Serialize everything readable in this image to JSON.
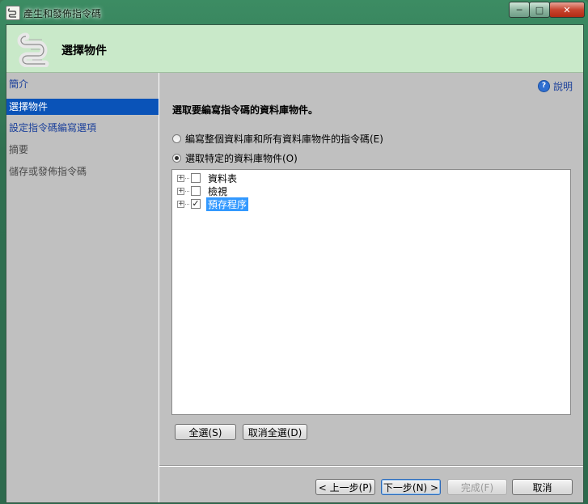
{
  "window": {
    "title": "產生和發佈指令碼",
    "controls": {
      "minimize": "─",
      "maximize": "□",
      "close": "✕"
    }
  },
  "header": {
    "title": "選擇物件",
    "icon": "script-scroll-icon"
  },
  "sidebar": {
    "items": [
      {
        "label": "簡介",
        "state": "link"
      },
      {
        "label": "選擇物件",
        "state": "selected"
      },
      {
        "label": "設定指令碼編寫選項",
        "state": "link"
      },
      {
        "label": "摘要",
        "state": "muted"
      },
      {
        "label": "儲存或發佈指令碼",
        "state": "muted"
      }
    ]
  },
  "help": {
    "label": "說明",
    "icon": "help-icon"
  },
  "main": {
    "instruction": "選取要編寫指令碼的資料庫物件。",
    "options": [
      {
        "label": "編寫整個資料庫和所有資料庫物件的指令碼(E)",
        "checked": false
      },
      {
        "label": "選取特定的資料庫物件(O)",
        "checked": true
      }
    ],
    "tree": [
      {
        "label": "資料表",
        "checked": false,
        "selected": false
      },
      {
        "label": "檢視",
        "checked": false,
        "selected": false
      },
      {
        "label": "預存程序",
        "checked": true,
        "selected": true
      }
    ],
    "select_all": "全選(S)",
    "deselect_all": "取消全選(D)"
  },
  "footer": {
    "previous": "< 上一步(P)",
    "next": "下一步(N) >",
    "finish": "完成(F)",
    "cancel": "取消"
  },
  "colors": {
    "header_bg": "#c9e9c9",
    "selection": "#0a53b8",
    "link": "#1a3f9a"
  }
}
